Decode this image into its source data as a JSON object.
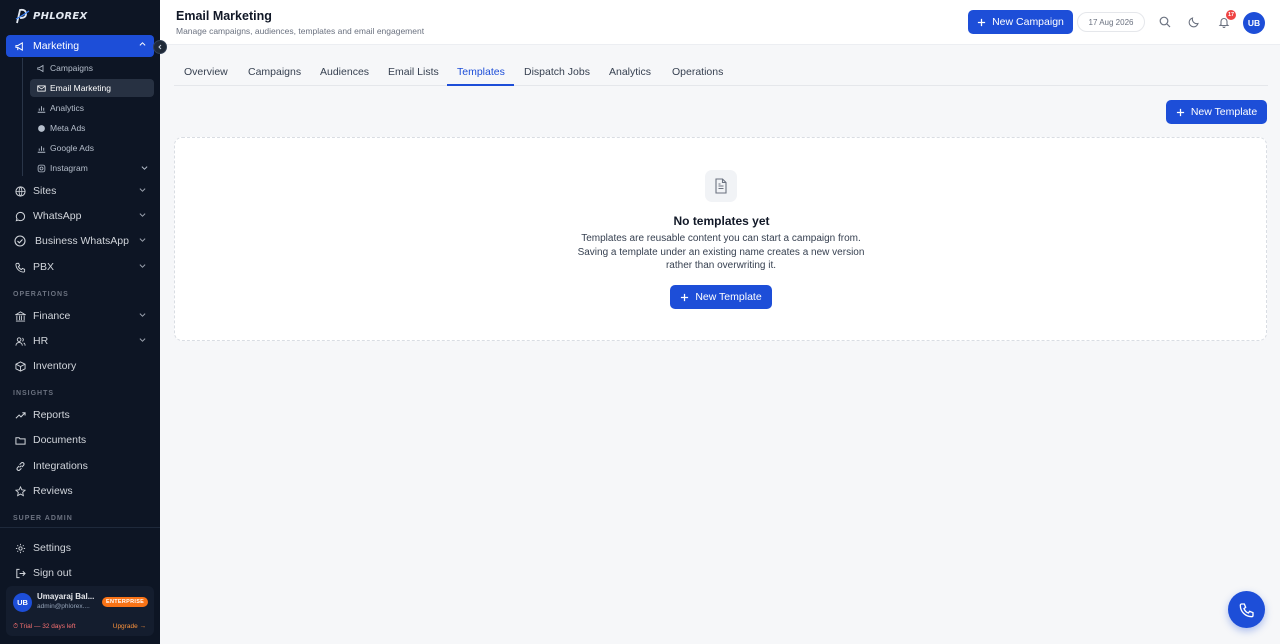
{
  "brand": {
    "logo_text": "PHLOREX",
    "accent": "#1d4ed8",
    "sidebar_bg": "#0d1524"
  },
  "sidebar": {
    "marketing": {
      "label": "Marketing",
      "icon": "megaphone-icon",
      "expanded": true
    },
    "marketing_items": [
      {
        "label": "Campaigns",
        "icon": "megaphone-icon"
      },
      {
        "label": "Email Marketing",
        "icon": "mail-icon",
        "active": true
      },
      {
        "label": "Analytics",
        "icon": "bar-chart-icon"
      },
      {
        "label": "Meta Ads",
        "icon": "globe-icon"
      },
      {
        "label": "Google Ads",
        "icon": "bar-chart-icon"
      },
      {
        "label": "Instagram",
        "icon": "instagram-icon"
      }
    ],
    "items_top": [
      {
        "label": "Sites",
        "icon": "globe-icon"
      },
      {
        "label": "WhatsApp",
        "icon": "chat-bubble-icon"
      },
      {
        "label": "Business WhatsApp",
        "icon": "check-circle-icon"
      },
      {
        "label": "PBX",
        "icon": "phone-icon"
      }
    ],
    "section_operations": "OPERATIONS",
    "items_operations": [
      {
        "label": "Finance",
        "icon": "bank-icon"
      },
      {
        "label": "HR",
        "icon": "users-icon"
      },
      {
        "label": "Inventory",
        "icon": "box-icon"
      }
    ],
    "section_insights": "INSIGHTS",
    "items_insights": [
      {
        "label": "Reports",
        "icon": "trending-up-icon"
      },
      {
        "label": "Documents",
        "icon": "folder-icon"
      },
      {
        "label": "Integrations",
        "icon": "link-icon"
      },
      {
        "label": "Reviews",
        "icon": "star-icon"
      }
    ],
    "section_super_admin": "SUPER ADMIN",
    "settings_label": "Settings",
    "signout_label": "Sign out",
    "user": {
      "initials": "UB",
      "name": "Umayaraj Bal...",
      "email": "admin@phlorex....",
      "plan": "ENTERPRISE",
      "trial": "⏱ Trial — 32 days left",
      "upgrade": "Upgrade →"
    }
  },
  "header": {
    "title": "Email Marketing",
    "subtitle": "Manage campaigns, audiences, templates and email engagement",
    "new_campaign_label": "New Campaign",
    "date": "17 Aug 2026",
    "notification_count": "17",
    "avatar_initials": "UB"
  },
  "tabs": [
    "Overview",
    "Campaigns",
    "Audiences",
    "Email Lists",
    "Templates",
    "Dispatch Jobs",
    "Analytics",
    "Operations"
  ],
  "active_tab": "Templates",
  "main": {
    "new_template_label": "New Template",
    "empty": {
      "title": "No templates yet",
      "description": "Templates are reusable content you can start a campaign from. Saving a template under an existing name creates a new version rather than overwriting it.",
      "button_label": "New Template"
    }
  }
}
